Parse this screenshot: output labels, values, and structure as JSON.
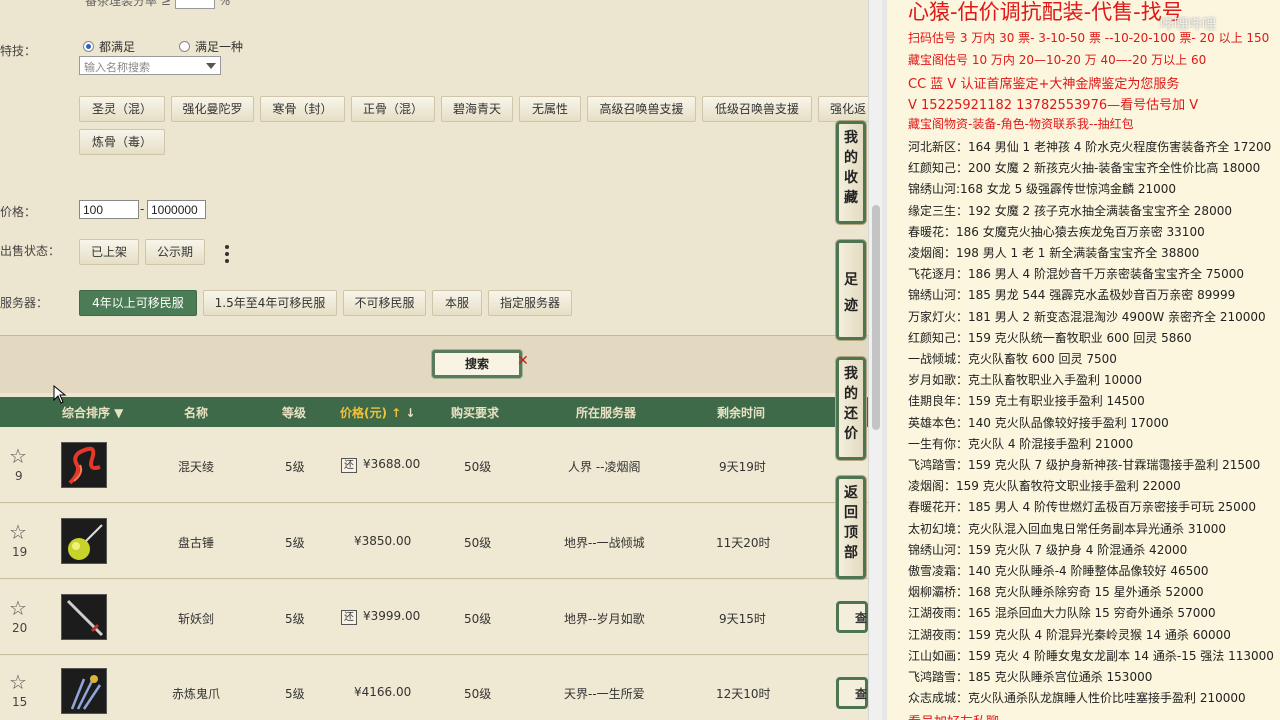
{
  "filters": {
    "top_cut_text": "番茶理装分率",
    "skills_label": "特技：",
    "radio_all": "都满足",
    "radio_one": "满足一种",
    "search_placeholder": "输入名称搜索",
    "skill_chips": [
      "圣灵（混）",
      "强化曼陀罗",
      "寒骨（封）",
      "正骨（混）",
      "碧海青天",
      "无属性",
      "高级召唤兽支援",
      "低级召唤兽支援",
      "强化返",
      "炼骨（毒）"
    ],
    "price_label": "价格：",
    "price_min": "100",
    "price_max": "1000000",
    "sale_status_label": "出售状态：",
    "sale_status_chips": [
      "已上架",
      "公示期"
    ],
    "server_label": "服务器：",
    "server_chips": [
      "4年以上可移民服",
      "1.5年至4年可移民服",
      "不可移民服",
      "本服",
      "指定服务器"
    ],
    "search_button": "搜索"
  },
  "table": {
    "headers": {
      "sort": "综合排序 ▼",
      "name": "名称",
      "level": "等级",
      "price": "价格(元)",
      "req": "购买要求",
      "server": "所在服务器",
      "remain": "剩余时间"
    },
    "rows": [
      {
        "fav": "9",
        "name": "混天绫",
        "level": "5级",
        "tag": "还",
        "price": "¥3688.00",
        "req": "50级",
        "server": "人界 --凌烟阁",
        "remain": "9天19时"
      },
      {
        "fav": "19",
        "name": "盘古锤",
        "level": "5级",
        "tag": "",
        "price": "¥3850.00",
        "req": "50级",
        "server": "地界--一战倾城",
        "remain": "11天20时"
      },
      {
        "fav": "20",
        "name": "斩妖剑",
        "level": "5级",
        "tag": "还",
        "price": "¥3999.00",
        "req": "50级",
        "server": "地界--岁月如歌",
        "remain": "9天15时"
      },
      {
        "fav": "15",
        "name": "赤炼鬼爪",
        "level": "5级",
        "tag": "",
        "price": "¥4166.00",
        "req": "50级",
        "server": "天界--一生所爱",
        "remain": "12天10时"
      }
    ]
  },
  "side": {
    "fav": "我的收藏",
    "footprint": "足迹",
    "bargain": "我的还价",
    "top": "返回顶部",
    "mini": "查"
  },
  "notes": {
    "title": "心猿-估价调抗配装-代售-找号",
    "watermark": "哔哩哔哩",
    "red_lines": [
      "扫码估号 3 万内 30 票- 3-10-50 票 --10-20-100 票- 20 以上 150",
      "藏宝阁估号 10 万内 20—10-20 万 40—-20 万以上 60",
      "CC 蓝 V 认证首席鉴定+大神金牌鉴定为您服务",
      "V 15225921182      13782553976—看号估号加 V",
      "藏宝阁物资-装备-角色-物资联系我--抽红包"
    ],
    "lines": [
      "河北新区：164 男仙 1 老神孩 4 阶水克火程度伤害装备齐全 17200",
      "红颜知己：200 女魔 2 新孩克火抽-装备宝宝齐全性价比高 18000",
      "锦绣山河:168 女龙 5 级强霹传世惊鸿金麟 21000",
      "缘定三生：192 女魔 2 孩子克水抽全满装备宝宝齐全 28000",
      "春暖花：186 女魔克火抽心猿去疾龙兔百万亲密 33100",
      "凌烟阁：198 男人 1 老 1 新全满装备宝宝齐全 38800",
      "飞花逐月：186 男人 4 阶混妙音千万亲密装备宝宝齐全 75000",
      "锦绣山河：185 男龙 544 强霹克水孟极妙音百万亲密 89999",
      "万家灯火：181 男人 2 新变态混混淘沙 4900W 亲密齐全 210000",
      "红颜知己：159 克火队统一畜牧职业 600 回灵 5860",
      "一战倾城：克火队畜牧 600 回灵 7500",
      "岁月如歌：克土队畜牧职业入手盈利 10000",
      "佳期良年：159 克土有职业接手盈利 14500",
      "英雄本色：140 克火队品像较好接手盈利 17000",
      "一生有你：克火队 4 阶混接手盈利 21000",
      "飞鸿踏雪：159 克火队 7 级护身新神孩-甘霖瑞霭接手盈利 21500",
      "凌烟阁：159 克火队畜牧符文职业接手盈利 22000",
      "春暖花开：185 男人 4 阶传世燃灯孟极百万亲密接手可玩 25000",
      "太初幻境：克火队混入回血鬼日常任务副本异光通杀 31000",
      "锦绣山河：159 克火队 7 级护身 4 阶混通杀 42000",
      "傲雪凌霜：140 克火队睡杀-4 阶睡整体品像较好 46500",
      "烟柳灞桥：168 克火队睡杀除穷奇 15 星外通杀 52000",
      "江湖夜雨：165 混杀回血大力队除 15 穷奇外通杀 57000",
      "江湖夜雨：159 克火队 4 阶混异光秦岭灵猴 14 通杀 60000",
      "江山如画：159 克火 4 阶睡女鬼女龙副本 14 通杀-15 强法 113000",
      "飞鸿踏雪：185 克火队睡杀宫位通杀 153000",
      "众志成城：克火队通杀队龙旗睡人性价比哇塞接手盈利 210000"
    ],
    "cut_bottom": "看号加好友私聊"
  }
}
